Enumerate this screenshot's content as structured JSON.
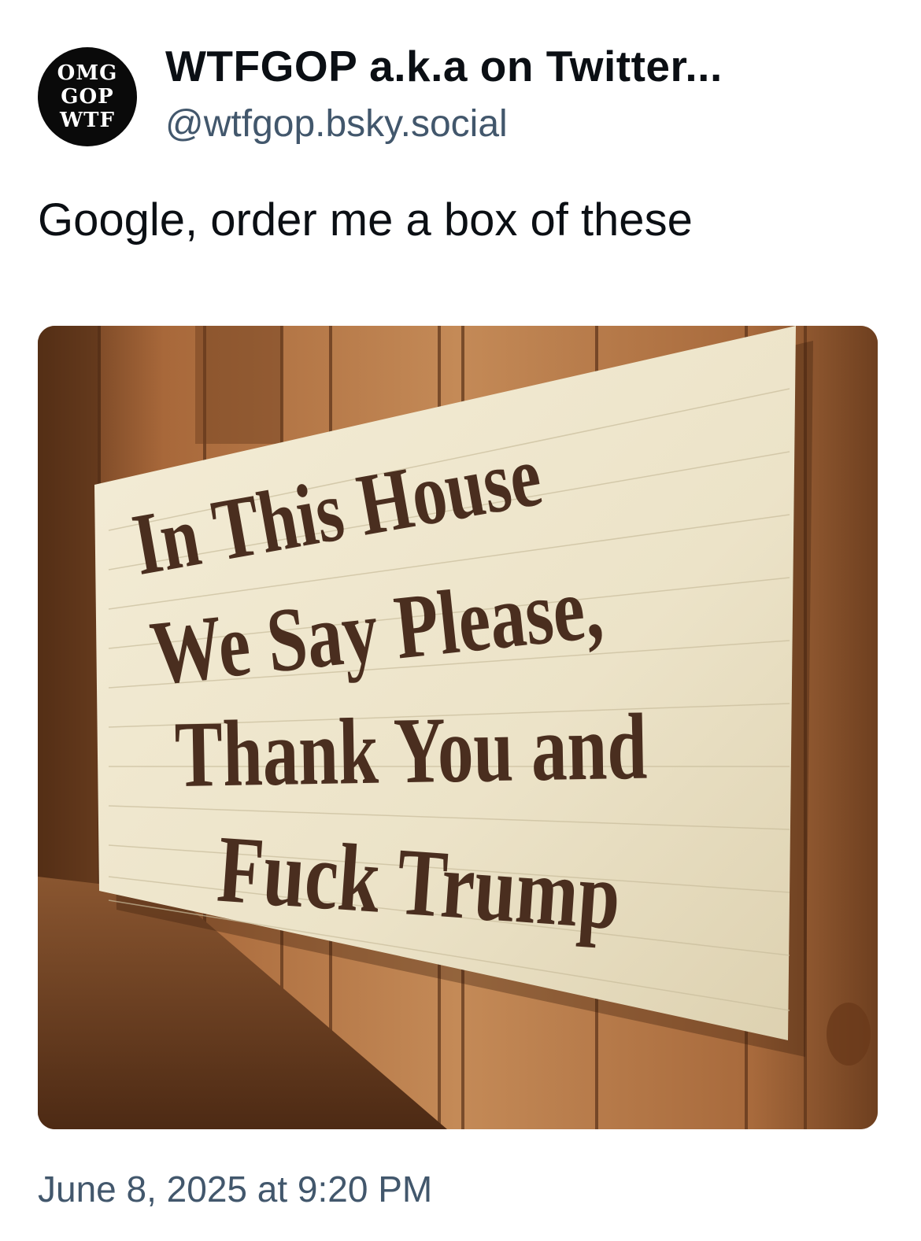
{
  "author": {
    "display_name": "WTFGOP a.k.a on Twitter...",
    "handle": "@wtfgop.bsky.social",
    "avatar_lines": [
      "OMG",
      "GOP",
      "WTF"
    ]
  },
  "post": {
    "text": "Google, order me a box of these",
    "timestamp": "June 8, 2025 at 9:20 PM"
  },
  "image": {
    "sign_lines": [
      "In This House",
      "We Say Please,",
      "Thank You and",
      "Fuck Trump"
    ],
    "colors": {
      "wood_light": "#c48a57",
      "wood_dark": "#6e3f1f",
      "sign": "#efe7cf",
      "lettering": "#4a2e1f"
    }
  },
  "colors": {
    "text": "#0b0f14",
    "muted": "#42576c",
    "background": "#ffffff"
  }
}
